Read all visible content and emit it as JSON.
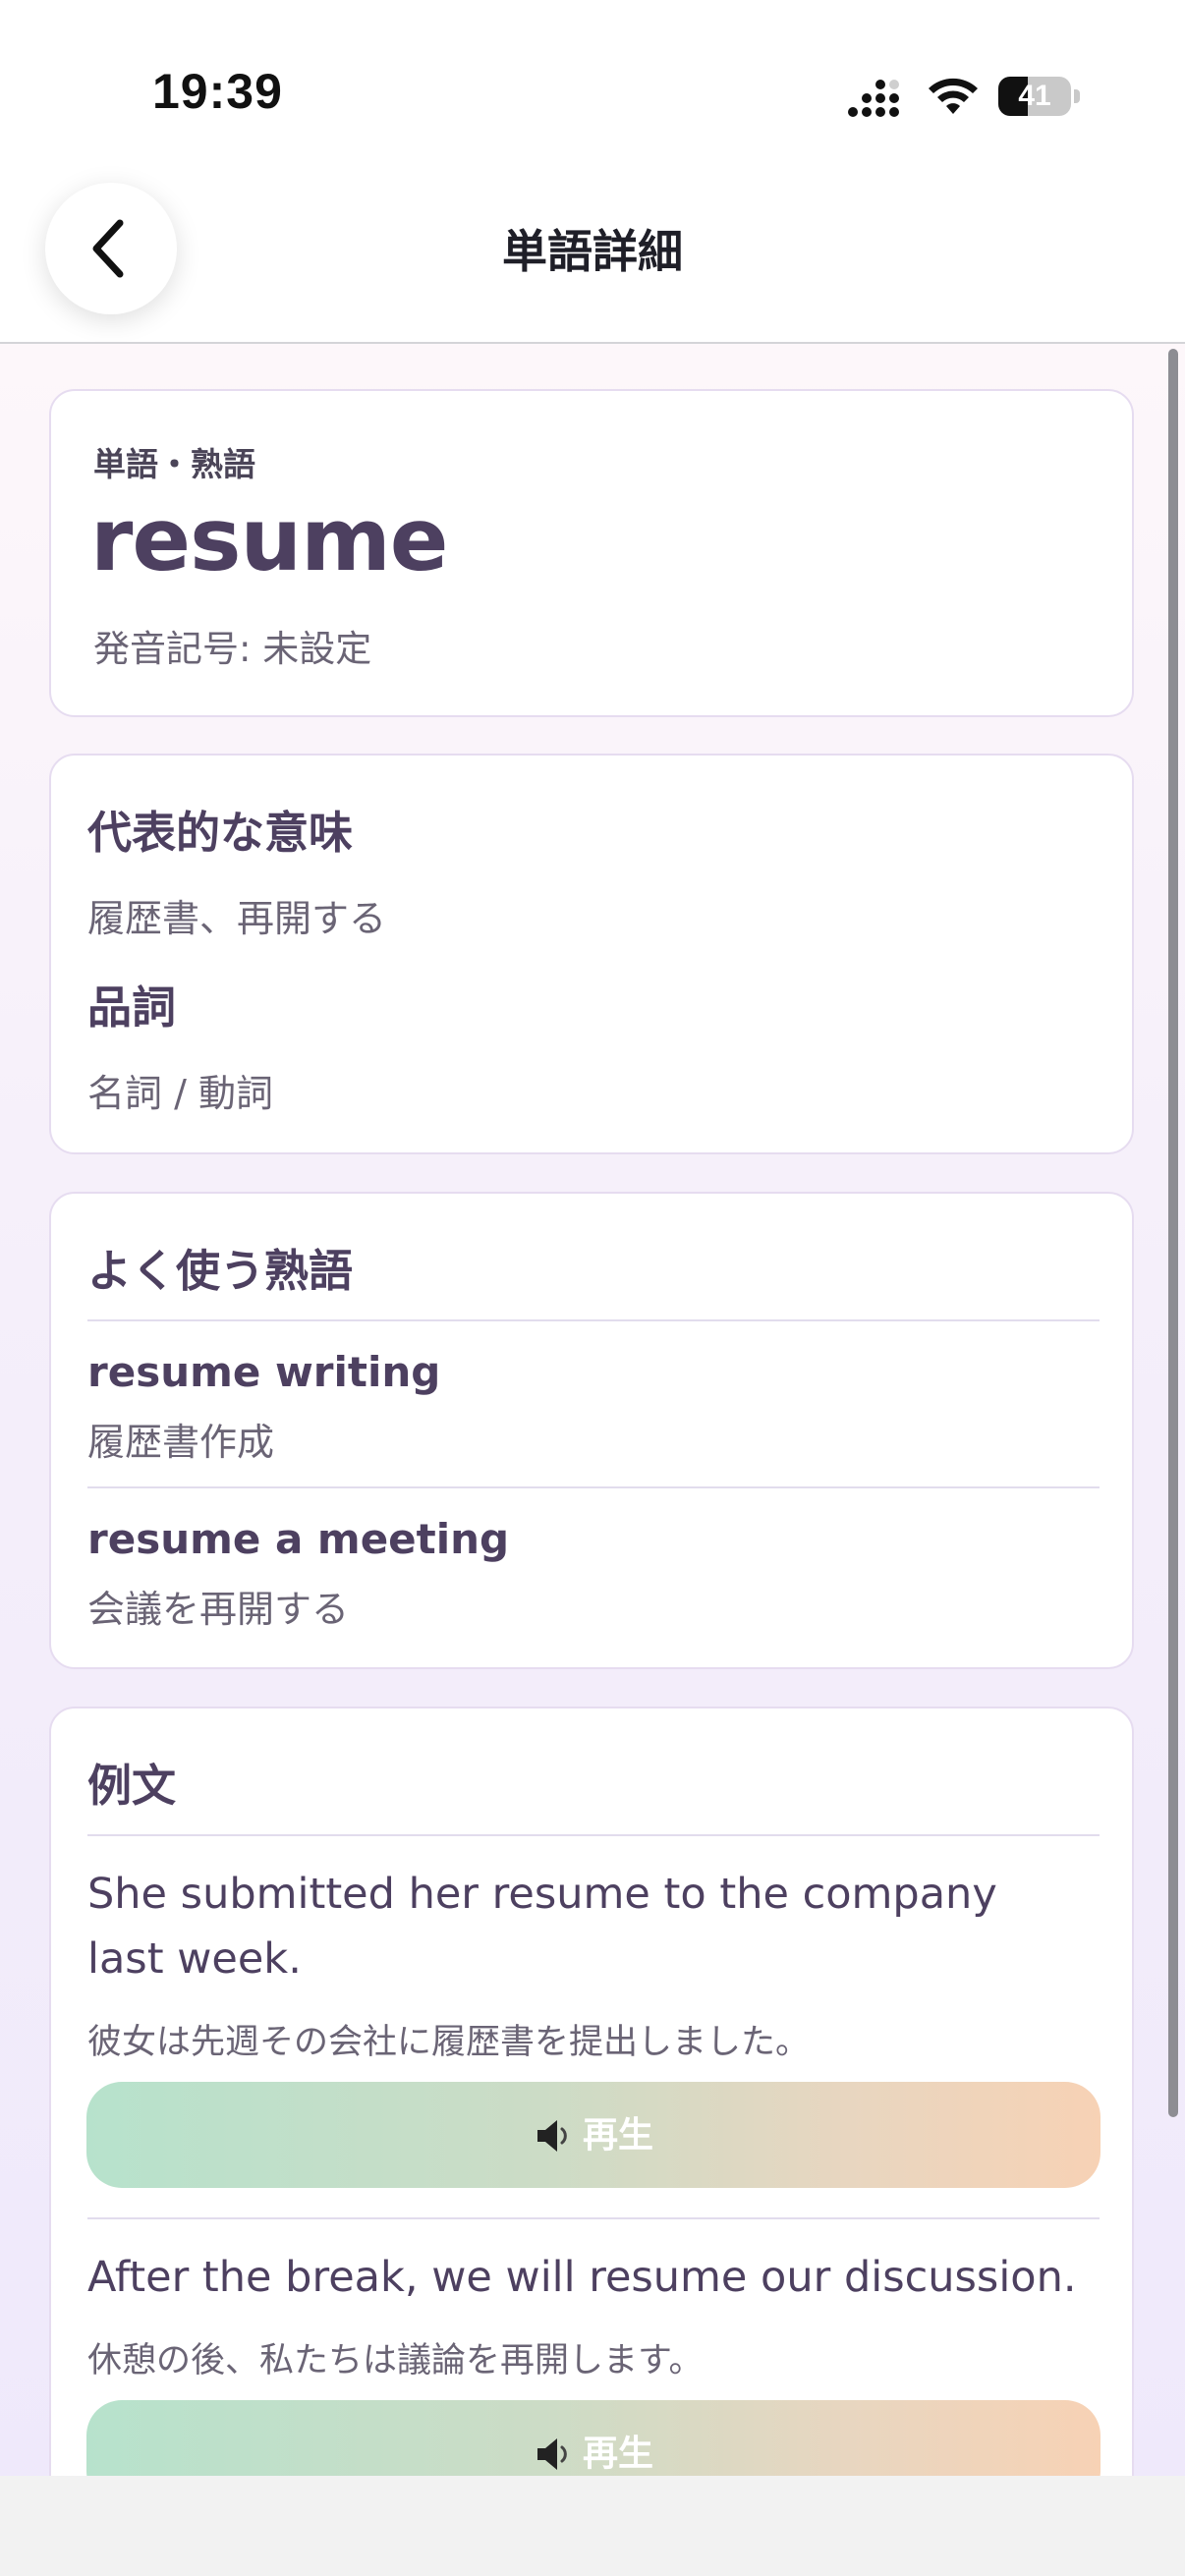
{
  "status": {
    "time": "19:39",
    "battery": "41",
    "battery_level": 0.41
  },
  "header": {
    "title": "単語詳細",
    "back_icon": "chevron-left-icon"
  },
  "word_card": {
    "kind": "単語・熟語",
    "word": "resume",
    "pronunciation": "発音記号: 未設定"
  },
  "meaning_card": {
    "meaning_heading": "代表的な意味",
    "meaning": "履歴書、再開する",
    "pos_heading": "品詞",
    "pos": "名詞 / 動詞"
  },
  "idioms": {
    "heading": "よく使う熟語",
    "items": [
      {
        "phrase": "resume writing",
        "meaning": "履歴書作成"
      },
      {
        "phrase": "resume a meeting",
        "meaning": "会議を再開する"
      }
    ]
  },
  "examples": {
    "heading": "例文",
    "items": [
      {
        "en": "She submitted her resume to the company last week.",
        "ja": "彼女は先週その会社に履歴書を提出しました。",
        "play_label": "再生",
        "play_icon": "speaker-icon"
      },
      {
        "en": "After the break, we will resume our discussion.",
        "ja": "休憩の後、私たちは議論を再開します。",
        "play_label": "再生",
        "play_icon": "speaker-icon"
      }
    ]
  }
}
